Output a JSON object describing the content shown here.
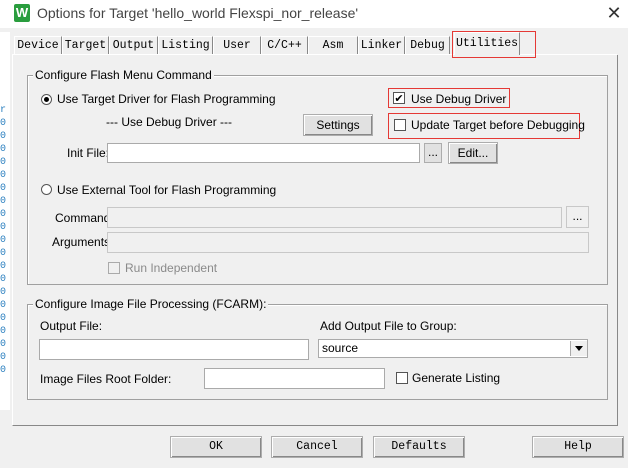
{
  "window": {
    "icon_letter": "W",
    "title": "Options for Target 'hello_world Flexspi_nor_release'",
    "close_glyph": "✕"
  },
  "tabs": [
    {
      "label": "Device",
      "active": false
    },
    {
      "label": "Target",
      "active": false
    },
    {
      "label": "Output",
      "active": false
    },
    {
      "label": "Listing",
      "active": false
    },
    {
      "label": "User",
      "active": false
    },
    {
      "label": "C/C++",
      "active": false
    },
    {
      "label": "Asm",
      "active": false
    },
    {
      "label": "Linker",
      "active": false
    },
    {
      "label": "Debug",
      "active": false
    },
    {
      "label": "Utilities",
      "active": true
    }
  ],
  "flash_group": {
    "title": "Configure Flash Menu Command",
    "use_target_driver": {
      "label": "Use Target Driver for Flash Programming",
      "checked": true
    },
    "use_debug_driver": {
      "label": "Use Debug Driver",
      "checked": true
    },
    "driver_name": "--- Use Debug Driver ---",
    "settings_label": "Settings",
    "update_target": {
      "label": "Update Target before Debugging",
      "checked": false
    },
    "init_file": {
      "label": "Init File:",
      "value": ""
    },
    "browse_label": "...",
    "edit_label": "Edit...",
    "use_external_tool": {
      "label": "Use External Tool for Flash Programming",
      "checked": false
    },
    "command": {
      "label": "Command:",
      "value": ""
    },
    "arguments": {
      "label": "Arguments:",
      "value": ""
    },
    "run_independent": {
      "label": "Run Independent",
      "checked": false
    }
  },
  "image_group": {
    "title": "Configure Image File Processing (FCARM):",
    "output_file": {
      "label": "Output File:",
      "value": ""
    },
    "add_output_group": {
      "label": "Add Output File  to Group:",
      "value": "source"
    },
    "root_folder": {
      "label": "Image Files Root Folder:",
      "value": ""
    },
    "generate_listing": {
      "label": "Generate Listing",
      "checked": false
    }
  },
  "footer": {
    "ok_label": "OK",
    "cancel_label": "Cancel",
    "defaults_label": "Defaults",
    "help_label": "Help"
  },
  "left_strip_chars": [
    "r",
    "0",
    "0",
    "0",
    "0",
    "0",
    "0",
    "0",
    "0",
    "0",
    "0",
    "0",
    "0",
    "0",
    "0",
    "0",
    "0",
    "0",
    "0",
    "0",
    "0"
  ],
  "icons": {
    "check": "✔",
    "checkbox_cross": "×"
  },
  "colors": {
    "annotation": "#e53935",
    "app_icon": "#2a9d3e",
    "dialog_bg": "#f0f0f0"
  }
}
